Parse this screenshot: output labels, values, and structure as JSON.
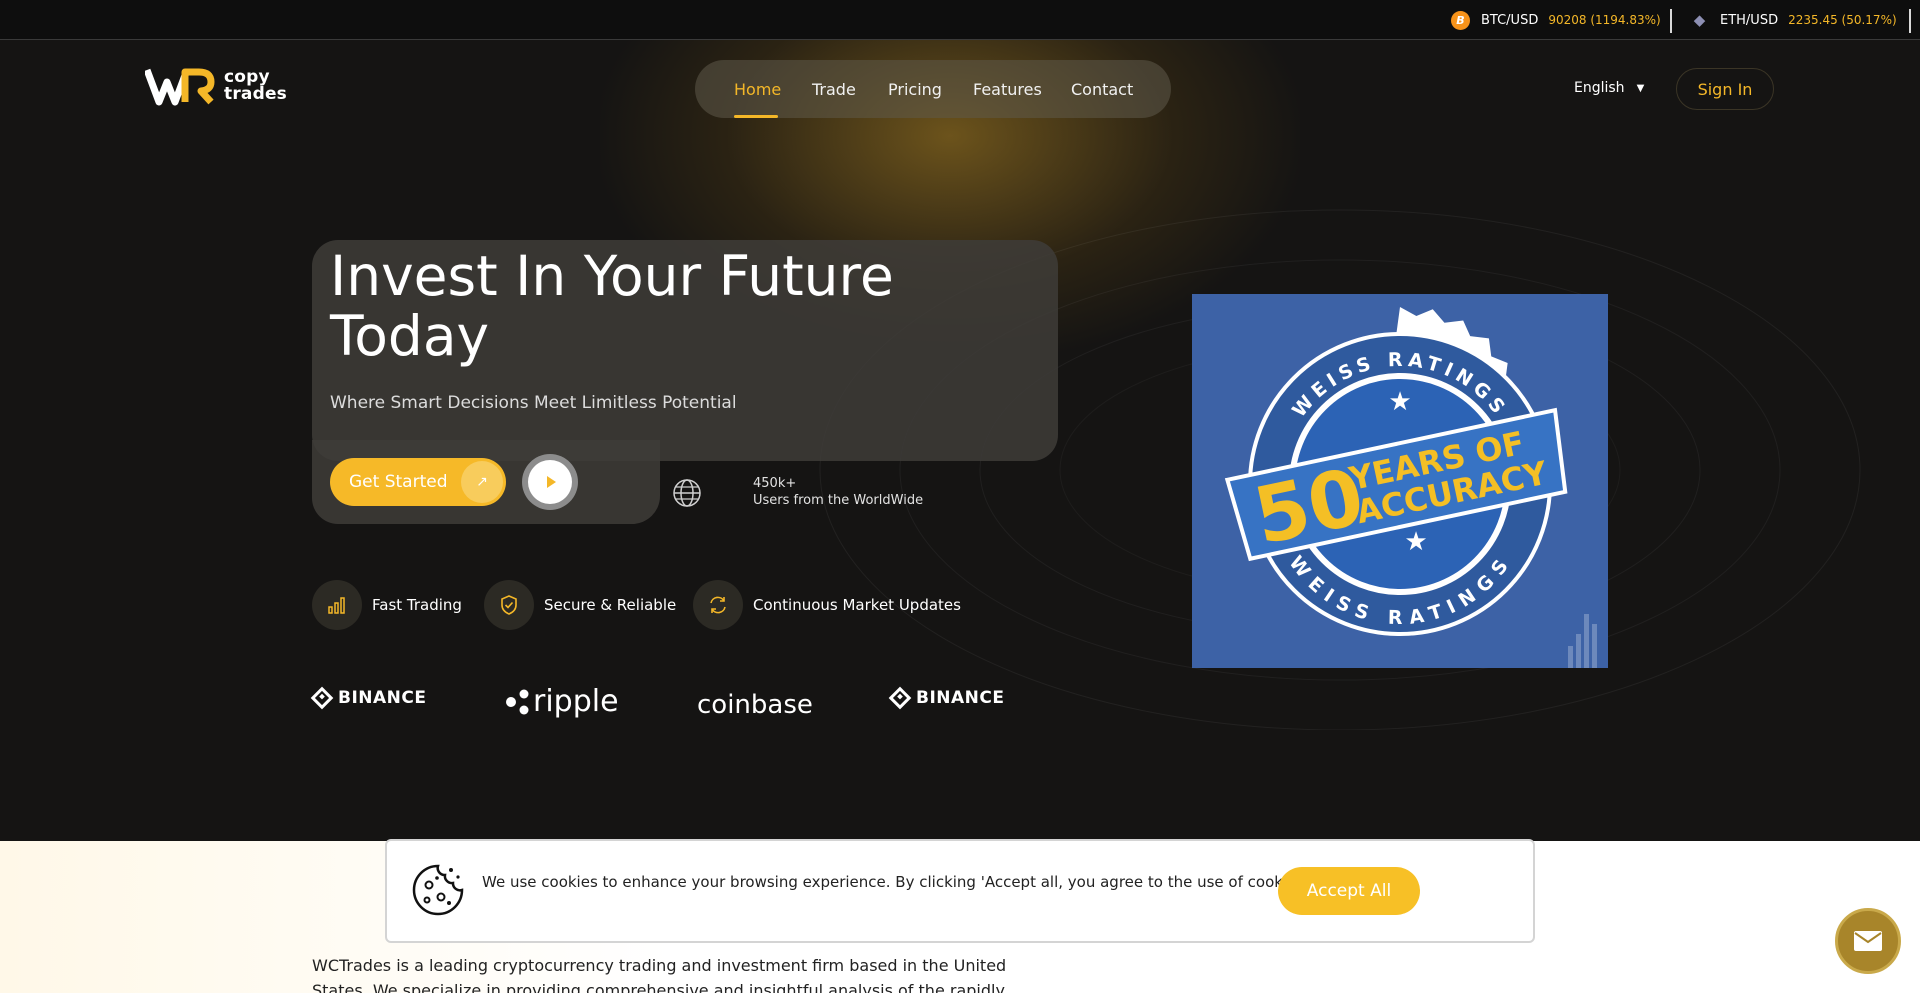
{
  "ticker": [
    {
      "symbol": "BTC/USD",
      "value": "90208 (1194.83%)",
      "icon": "bitcoin-icon"
    },
    {
      "symbol": "ETH/USD",
      "value": "2235.45 (50.17%)",
      "icon": "ethereum-icon"
    }
  ],
  "brand": {
    "line1": "copy",
    "line2": "trades"
  },
  "nav": {
    "items": [
      "Home",
      "Trade",
      "Pricing",
      "Features",
      "Contact"
    ],
    "active": "Home"
  },
  "header": {
    "language": "English",
    "sign_in": "Sign In"
  },
  "hero": {
    "title_line1": "Invest In Your Future",
    "title_line2": "Today",
    "subtitle": "Where Smart Decisions Meet Limitless Potential",
    "cta": "Get Started",
    "users_count": "450k+",
    "users_label": "Users from the WorldWide"
  },
  "features": [
    {
      "label": "Fast Trading",
      "icon": "bar-chart-icon"
    },
    {
      "label": "Secure & Reliable",
      "icon": "shield-check-icon"
    },
    {
      "label": "Continuous Market Updates",
      "icon": "refresh-icon"
    }
  ],
  "partners": [
    "BINANCE",
    "ripple",
    "coinbase",
    "BINANCE"
  ],
  "badge": {
    "top": "WEISS RATINGS",
    "number": "50",
    "line1": "YEARS OF",
    "line2": "ACCURACY",
    "bottom": "WEISS RATINGS"
  },
  "cookie": {
    "text": "We use cookies to enhance your browsing experience. By clicking 'Accept all, you agree to the use of cookies.",
    "accept": "Accept All"
  },
  "about": {
    "text": "WCTrades is a leading cryptocurrency trading and investment firm based in the United States. We specialize in providing comprehensive and insightful analysis of the rapidly evolving cryptocurrency"
  },
  "colors": {
    "accent": "#f4b728",
    "background": "#151413",
    "badge_blue": "#3d62a6"
  }
}
